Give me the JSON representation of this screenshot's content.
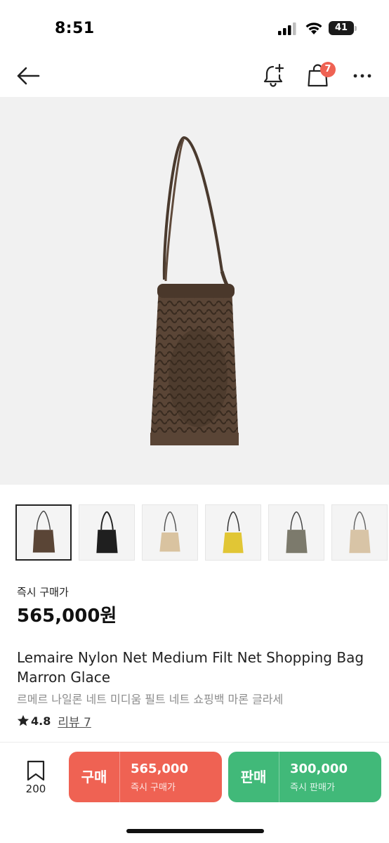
{
  "status_bar": {
    "time": "8:51",
    "battery": "41"
  },
  "header": {
    "cart_count": "7"
  },
  "product": {
    "price_label": "즉시 구매가",
    "price": "565,000원",
    "title_en": "Lemaire Nylon Net Medium Filt Net Shopping Bag Marron Glace",
    "title_ko": "르메르 나일론 네트 미디움 필트 네트 쇼핑백 마론 글라세",
    "rating": "4.8",
    "review_label": "리뷰 7"
  },
  "thumbnails": [
    {
      "color": "#5a4536"
    },
    {
      "color": "#1f1f1f"
    },
    {
      "color": "#d9c3a0"
    },
    {
      "color": "#e1c635"
    },
    {
      "color": "#7c7a6c"
    },
    {
      "color": "#d8c4a6"
    }
  ],
  "bottom_bar": {
    "bookmark_count": "200",
    "buy": {
      "label": "구매",
      "price": "565,000",
      "sub": "즉시 구매가"
    },
    "sell": {
      "label": "판매",
      "price": "300,000",
      "sub": "즉시 판매가"
    }
  },
  "colors": {
    "buy": "#ef6253",
    "sell": "#41b979",
    "bag": "#5a4536"
  }
}
